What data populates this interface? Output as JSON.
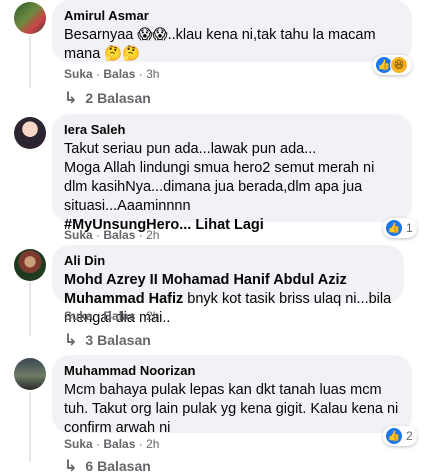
{
  "comments": [
    {
      "author": "Amirul Asmar",
      "text": "Besarnyaa 😱😱..klau kena ni,tak tahu la macam mana 🤔🤔",
      "reactions": {
        "icons": [
          "like-icon",
          "haha-icon"
        ],
        "glyphs": [
          "👍",
          "😆"
        ],
        "count": ""
      },
      "actions": {
        "like": "Suka",
        "reply": "Balas",
        "time": "3h"
      },
      "replies": "2 Balasan"
    },
    {
      "author": "Iera Saleh",
      "text": "Takut seriau pun ada...lawak pun ada...\nMoga Allah lindungi smua hero2 semut merah ni dlm kasihNya...dimana jua berada,dlm apa jua situasi...Aaaminnnn",
      "tag_line": "#MyUnsungHero... Lihat Lagi",
      "reactions": {
        "icons": [
          "like-icon"
        ],
        "glyphs": [
          "👍"
        ],
        "count": "1"
      },
      "actions": {
        "like": "Suka",
        "reply": "Balas",
        "time": "2h"
      }
    },
    {
      "author": "Ali Din",
      "mention": "Mohd Azrey II Mohamad Hanif Abdul Aziz Muhammad Hafiz",
      "text": "bnyk kot tasik briss ulaq ni...bila mengai dia mai..",
      "actions": {
        "like": "Suka",
        "reply": "Balas",
        "time": "2h"
      },
      "replies": "3 Balasan"
    },
    {
      "author": "Muhammad Noorizan",
      "text": "Mcm bahaya pulak lepas kan dkt tanah luas mcm tuh. Takut org lain pulak yg kena gigit. Kalau kena ni confirm arwah ni",
      "reactions": {
        "icons": [
          "like-icon"
        ],
        "glyphs": [
          "👍"
        ],
        "count": "2"
      },
      "actions": {
        "like": "Suka",
        "reply": "Balas",
        "time": "2h"
      },
      "replies": "6 Balasan"
    }
  ],
  "separator": " · "
}
